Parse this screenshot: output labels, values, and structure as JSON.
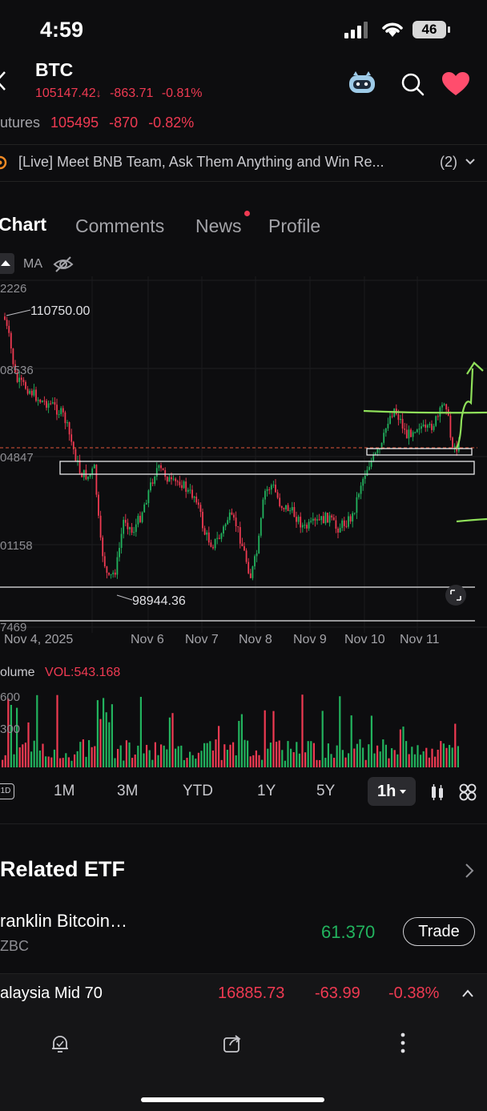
{
  "status_bar": {
    "time": "4:59",
    "battery": "46"
  },
  "header": {
    "symbol": "BTC",
    "price": "105147.42",
    "change": "-863.71",
    "change_pct": "-0.81%",
    "icons": [
      "back-icon",
      "assistant-robot-icon",
      "search-icon",
      "favorite-heart-icon"
    ]
  },
  "futures": {
    "label": "utures",
    "price": "105495",
    "change": "-870",
    "change_pct": "-0.82%"
  },
  "live_banner": {
    "text": "[Live] Meet BNB Team, Ask Them Anything and Win Re...",
    "count": "(2)"
  },
  "tabs": [
    {
      "label": "Chart",
      "active": true
    },
    {
      "label": "Comments",
      "active": false
    },
    {
      "label": "News",
      "active": false,
      "dot": true
    },
    {
      "label": "Profile",
      "active": false
    }
  ],
  "indicator_bar": {
    "ma_label": "MA"
  },
  "chart_data": {
    "type": "candlestick",
    "y_tick_labels": [
      "2226",
      "08536",
      "04847",
      "01158",
      "7469"
    ],
    "x_tick_labels": [
      "Nov 4, 2025",
      "Nov 6",
      "Nov 7",
      "Nov 8",
      "Nov 9",
      "Nov 10",
      "Nov 11"
    ],
    "annotations": {
      "high": "110750.00",
      "low": "98944.36"
    },
    "colors": {
      "up": "#22b35e",
      "down": "#ef3a52",
      "drawing": "#8fe05a"
    }
  },
  "volume": {
    "label": "olume",
    "vol_label": "VOL:543.168",
    "y_tick_labels": [
      "600",
      "300"
    ]
  },
  "range_selector": {
    "options": [
      "1D",
      "1M",
      "3M",
      "YTD",
      "1Y",
      "5Y"
    ],
    "interval": "1h"
  },
  "related_etf": {
    "title": "Related ETF",
    "item": {
      "name": "ranklin Bitcoin…",
      "ticker": "ZBC",
      "price": "61.370",
      "action": "Trade"
    }
  },
  "ticker_bar": {
    "name": "alaysia Mid 70",
    "value": "16885.73",
    "change": "-63.99",
    "change_pct": "-0.38%"
  }
}
